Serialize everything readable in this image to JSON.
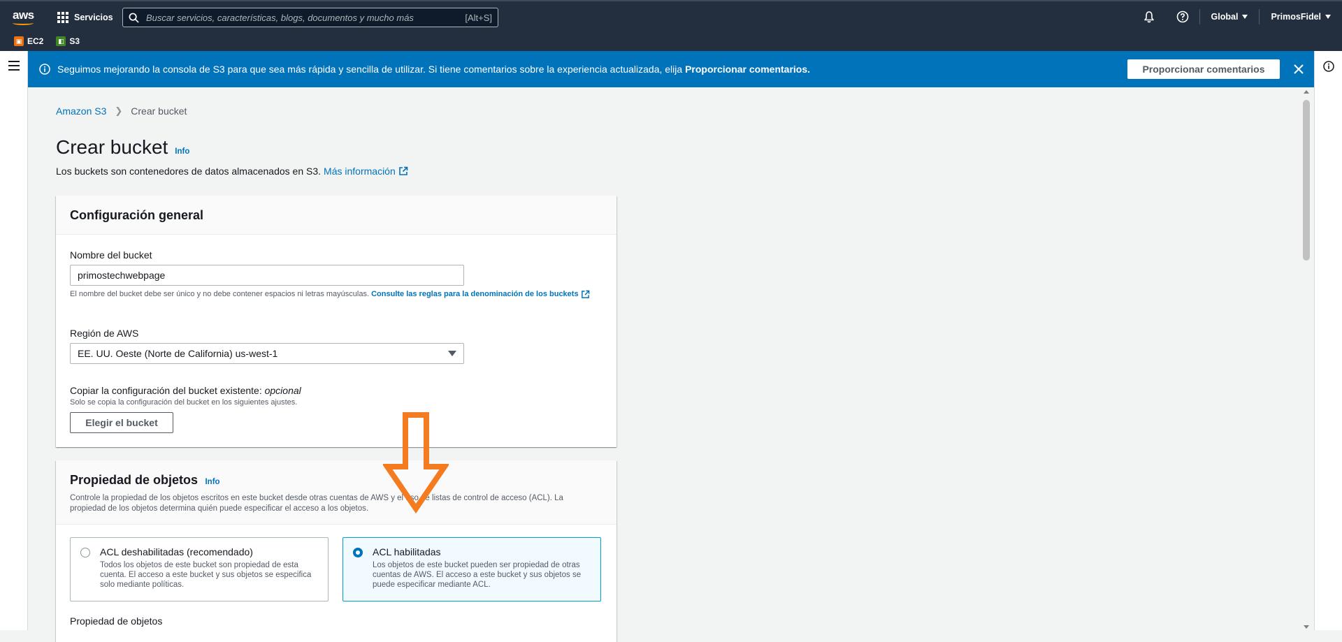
{
  "topnav": {
    "logo": "aws",
    "services_label": "Servicios",
    "search_placeholder": "Buscar servicios, características, blogs, documentos y mucho más",
    "search_shortcut": "[Alt+S]",
    "region_label": "Global",
    "account_label": "PrimosFidel",
    "icons": [
      "bell-icon",
      "help-icon"
    ]
  },
  "favorites": [
    {
      "label": "EC2",
      "icon": "ec2-icon",
      "color": "#ec7211"
    },
    {
      "label": "S3",
      "icon": "s3-icon",
      "color": "#3f8624"
    }
  ],
  "banner": {
    "text_prefix": "Seguimos mejorando la consola de S3 para que sea más rápida y sencilla de utilizar. Si tiene comentarios sobre la experiencia actualizada, elija ",
    "text_bold": "Proporcionar comentarios.",
    "button_label": "Proporcionar comentarios",
    "color": "#0073bb"
  },
  "breadcrumb": {
    "root": "Amazon S3",
    "current": "Crear bucket"
  },
  "page": {
    "title": "Crear bucket",
    "info": "Info",
    "description": "Los buckets son contenedores de datos almacenados en S3.",
    "more_info_link": "Más información"
  },
  "general_config": {
    "title": "Configuración general",
    "bucket_name_label": "Nombre del bucket",
    "bucket_name_value": "primostechwebpage",
    "bucket_name_help": "El nombre del bucket debe ser único y no debe contener espacios ni letras mayúsculas.",
    "bucket_name_rules_link": "Consulte las reglas para la denominación de los buckets",
    "region_label": "Región de AWS",
    "region_value": "EE. UU. Oeste (Norte de California) us-west-1",
    "copy_label": "Copiar la configuración del bucket existente:",
    "copy_optional": "opcional",
    "copy_help": "Solo se copia la configuración del bucket en los siguientes ajustes.",
    "choose_bucket_button": "Elegir el bucket"
  },
  "object_ownership": {
    "title": "Propiedad de objetos",
    "info": "Info",
    "description": "Controle la propiedad de los objetos escritos en este bucket desde otras cuentas de AWS y el uso de listas de control de acceso (ACL). La propiedad de los objetos determina quién puede especificar el acceso a los objetos.",
    "options": [
      {
        "title": "ACL deshabilitadas (recomendado)",
        "description": "Todos los objetos de este bucket son propiedad de esta cuenta. El acceso a este bucket y sus objetos se especifica solo mediante políticas.",
        "selected": false
      },
      {
        "title": "ACL habilitadas",
        "description": "Los objetos de este bucket pueden ser propiedad de otras cuentas de AWS. El acceso a este bucket y sus objetos se puede especificar mediante ACL.",
        "selected": true
      }
    ],
    "next_label": "Propiedad de objetos"
  },
  "annotation": {
    "arrow_color": "#f47b20"
  }
}
